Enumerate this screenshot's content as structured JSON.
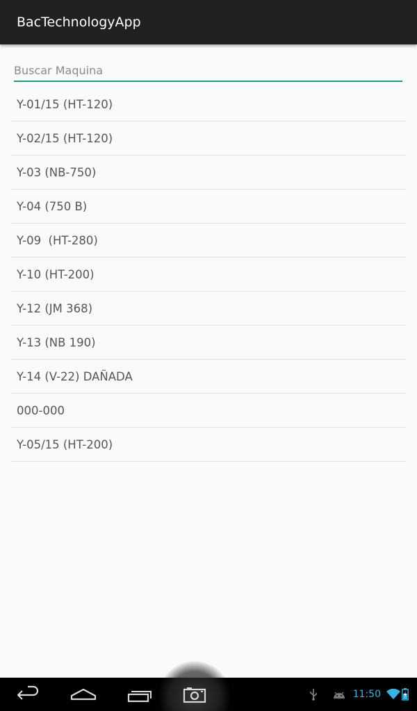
{
  "app": {
    "title": "BacTechnologyApp"
  },
  "search": {
    "placeholder": "Buscar Maquina",
    "value": ""
  },
  "machines": [
    {
      "label": "Y-01/15 (HT-120)"
    },
    {
      "label": "Y-02/15 (HT-120)"
    },
    {
      "label": "Y-03 (NB-750)"
    },
    {
      "label": "Y-04 (750 B)"
    },
    {
      "label": "Y-09  (HT-280)"
    },
    {
      "label": "Y-10 (HT-200)"
    },
    {
      "label": "Y-12 (JM 368)"
    },
    {
      "label": "Y-13 (NB 190)"
    },
    {
      "label": "Y-14 (V-22) DAÑADA"
    },
    {
      "label": "000-000"
    },
    {
      "label": "Y-05/15 (HT-200)"
    }
  ],
  "nav_bar": {
    "buttons": [
      "back-icon",
      "home-icon",
      "recent-apps-icon",
      "camera-icon"
    ]
  },
  "status_bar": {
    "time": "11:50",
    "icons": [
      "usb-icon",
      "android-debug-icon",
      "wifi-icon",
      "battery-icon"
    ],
    "accent_color": "#33b5e5"
  },
  "colors": {
    "action_bar": "#212121",
    "search_underline": "#16988a",
    "background": "#fafafa"
  }
}
